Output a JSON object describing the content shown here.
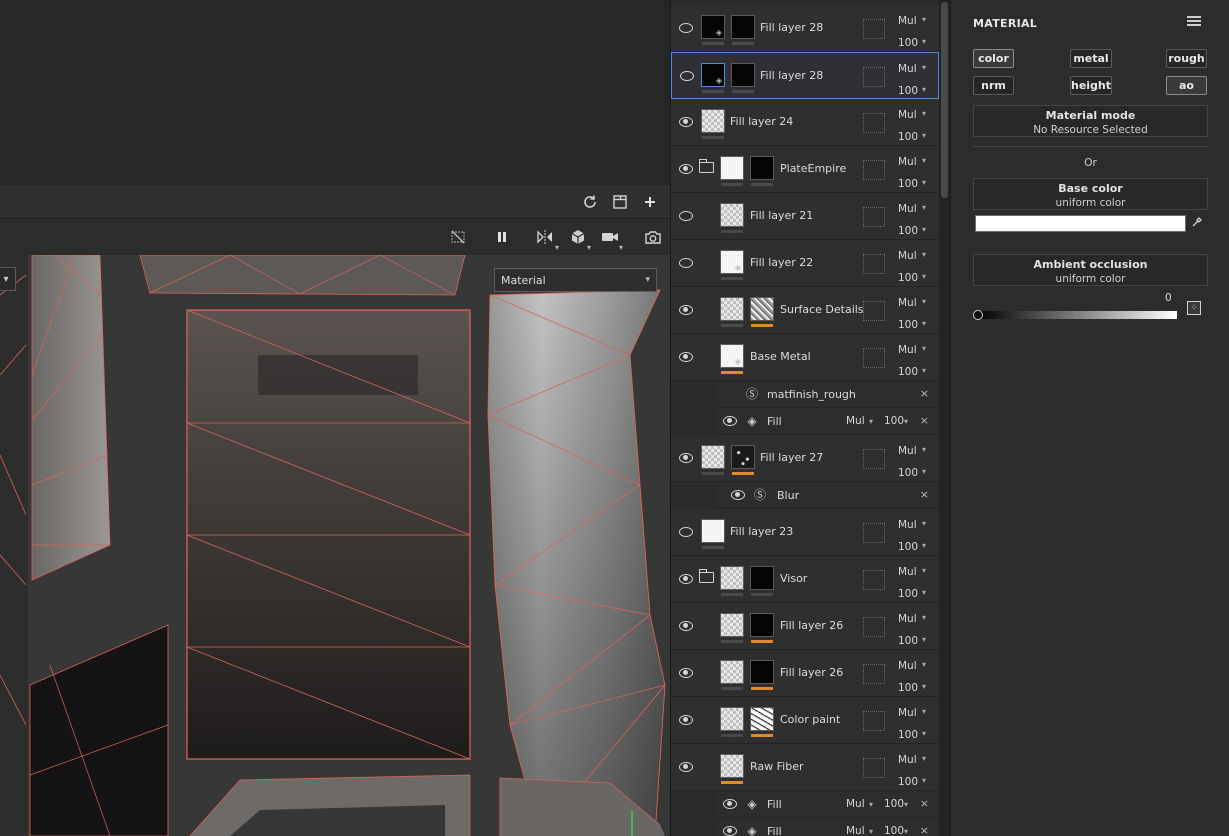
{
  "viewport": {
    "mode_select": "Material"
  },
  "layers": [
    {
      "name": "Fill layer 28",
      "blend": "Mul",
      "opacity": "100"
    },
    {
      "name": "Fill layer 28",
      "blend": "Mul",
      "opacity": "100"
    },
    {
      "name": "Fill layer 24",
      "blend": "Mul",
      "opacity": "100"
    },
    {
      "name": "PlateEmpire",
      "blend": "Mul",
      "opacity": "100"
    },
    {
      "name": "Fill layer 21",
      "blend": "Mul",
      "opacity": "100"
    },
    {
      "name": "Fill layer 22",
      "blend": "Mul",
      "opacity": "100"
    },
    {
      "name": "Surface Details",
      "blend": "Mul",
      "opacity": "100"
    },
    {
      "name": "Base Metal",
      "blend": "Mul",
      "opacity": "100"
    },
    {
      "name": "Fill layer 27",
      "blend": "Mul",
      "opacity": "100"
    },
    {
      "name": "Fill layer 23",
      "blend": "Mul",
      "opacity": "100"
    },
    {
      "name": "Visor",
      "blend": "Mul",
      "opacity": "100"
    },
    {
      "name": "Fill layer 26",
      "blend": "Mul",
      "opacity": "100"
    },
    {
      "name": "Fill layer 26",
      "blend": "Mul",
      "opacity": "100"
    },
    {
      "name": "Color paint",
      "blend": "Mul",
      "opacity": "100"
    },
    {
      "name": "Raw Fiber",
      "blend": "Mul",
      "opacity": "100"
    }
  ],
  "effects": {
    "base_metal_filter": {
      "name": "matfinish_rough"
    },
    "base_metal_fill": {
      "name": "Fill",
      "blend": "Mul",
      "opacity": "100"
    },
    "fill27_filter": {
      "name": "Blur"
    },
    "raw_fiber_fill1": {
      "name": "Fill",
      "blend": "Mul",
      "opacity": "100"
    },
    "raw_fiber_fill2": {
      "name": "Fill",
      "blend": "Mul",
      "opacity": "100"
    }
  },
  "props": {
    "title": "MATERIAL",
    "channels": [
      "color",
      "metal",
      "rough",
      "nrm",
      "height",
      "ao"
    ],
    "material_mode": {
      "title": "Material mode",
      "value": "No Resource Selected"
    },
    "or_label": "Or",
    "base_color": {
      "title": "Base color",
      "value": "uniform color",
      "swatch": "#ffffff"
    },
    "ambient_occlusion": {
      "title": "Ambient occlusion",
      "value": "uniform color",
      "amount": "0"
    }
  },
  "colors": {
    "accent_selected": "#4a8ed8",
    "mask_bar": "#e08a2a",
    "uv_edges": "#e0665a"
  }
}
